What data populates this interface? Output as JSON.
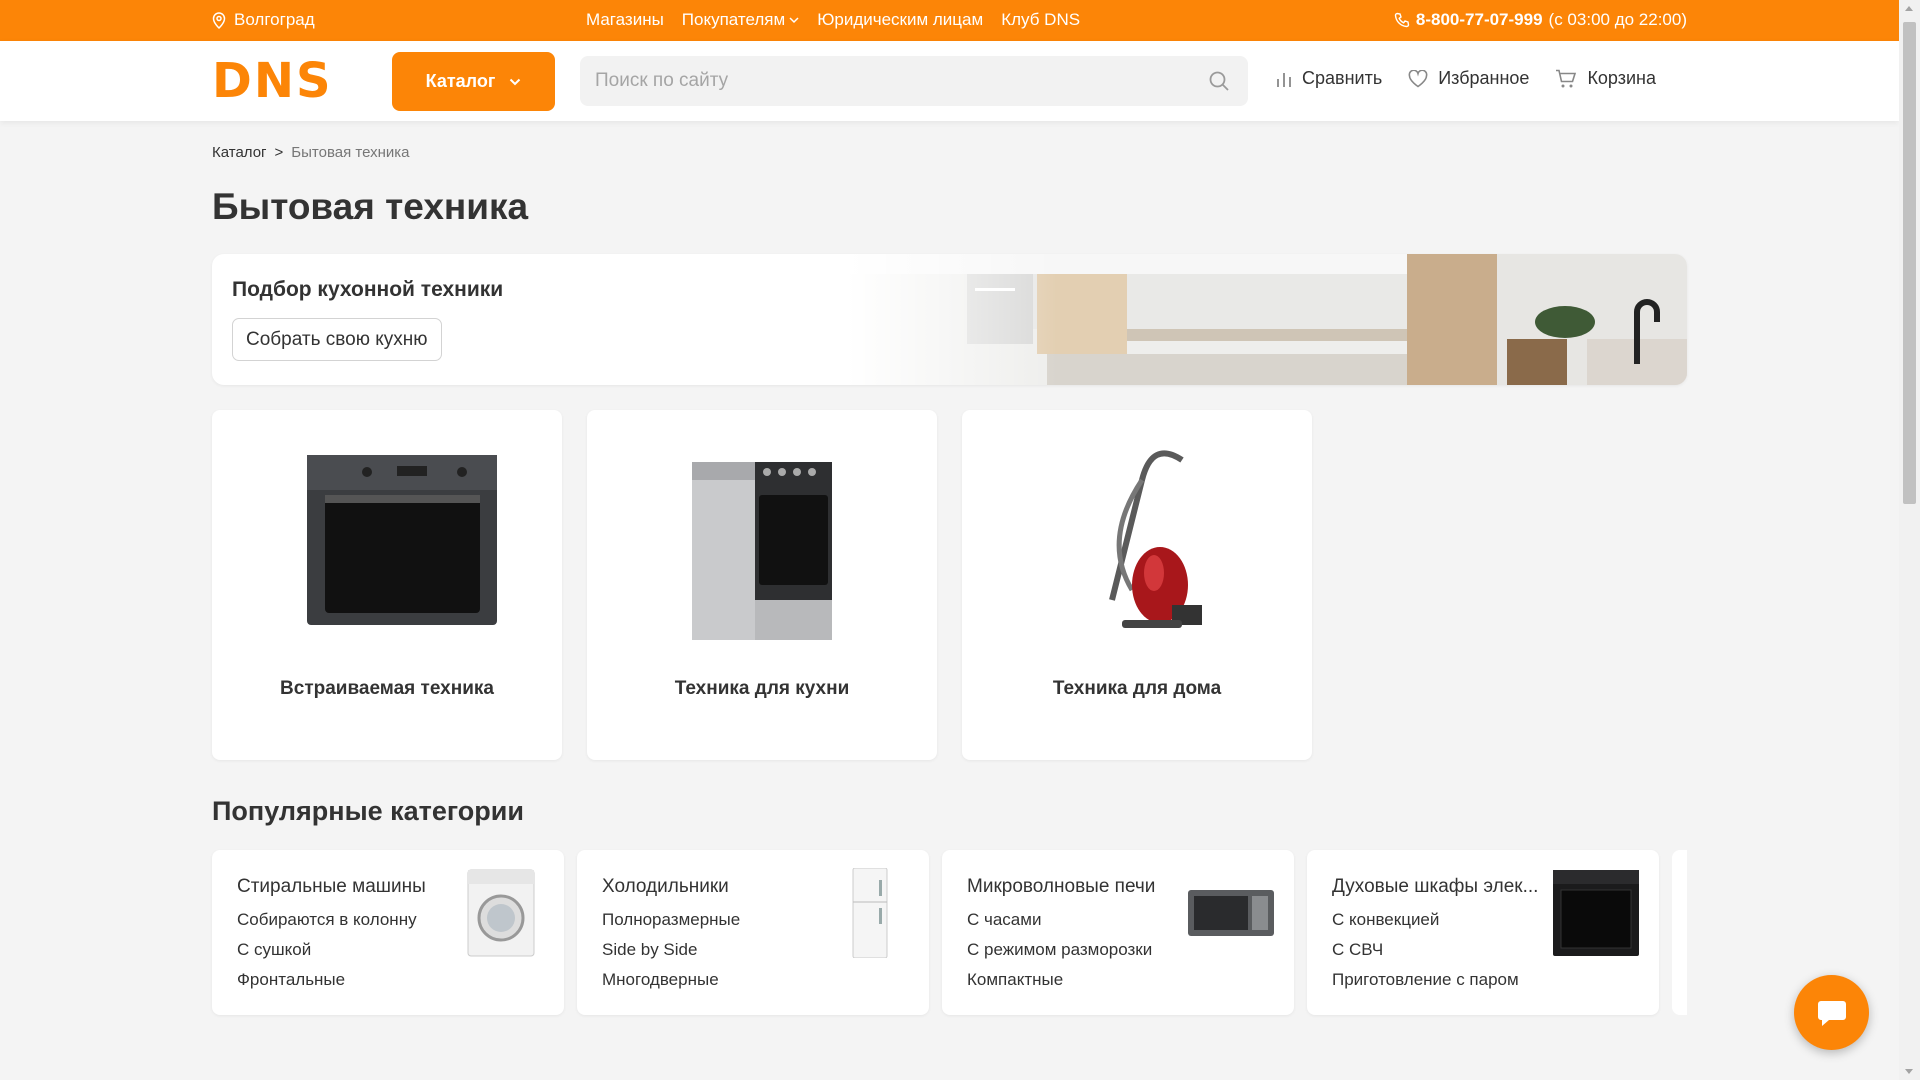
{
  "topbar": {
    "city": "Волгоград",
    "nav": [
      "Магазины",
      "Покупателям",
      "Юридическим лицам",
      "Клуб DNS"
    ],
    "phone": "8-800-77-07-999",
    "hours": "(с 03:00 до 22:00)"
  },
  "header": {
    "logo": "DNS",
    "catalog_label": "Каталог",
    "search_placeholder": "Поиск по сайту",
    "compare_label": "Сравнить",
    "favorites_label": "Избранное",
    "cart_label": "Корзина"
  },
  "breadcrumb": {
    "root": "Каталог",
    "separator": ">",
    "current": "Бытовая техника"
  },
  "page_title": "Бытовая техника",
  "kitchen_banner": {
    "title": "Подбор кухонной техники",
    "button": "Собрать свою кухню"
  },
  "categories": [
    {
      "label": "Встраиваемая техника",
      "icon": "oven-image"
    },
    {
      "label": "Техника для кухни",
      "icon": "stove-image"
    },
    {
      "label": "Техника для дома",
      "icon": "vacuum-image"
    }
  ],
  "popular_title": "Популярные категории",
  "popular": [
    {
      "title": "Стиральные машины",
      "subs": [
        "Собираются в колонну",
        "С сушкой",
        "Фронтальные"
      ],
      "icon": "washing-machine-image"
    },
    {
      "title": "Холодильники",
      "subs": [
        "Полноразмерные",
        "Side by Side",
        "Многодверные"
      ],
      "icon": "fridge-image"
    },
    {
      "title": "Микроволновые печи",
      "subs": [
        "С часами",
        "С режимом разморозки",
        "Компактные"
      ],
      "icon": "microwave-image"
    },
    {
      "title": "Духовые шкафы элек...",
      "subs": [
        "С конвекцией",
        "С СВЧ",
        "Приготовление с паром"
      ],
      "icon": "oven-image"
    }
  ],
  "colors": {
    "accent": "#fc8507",
    "background": "#f4f4f4",
    "text": "#333333"
  }
}
